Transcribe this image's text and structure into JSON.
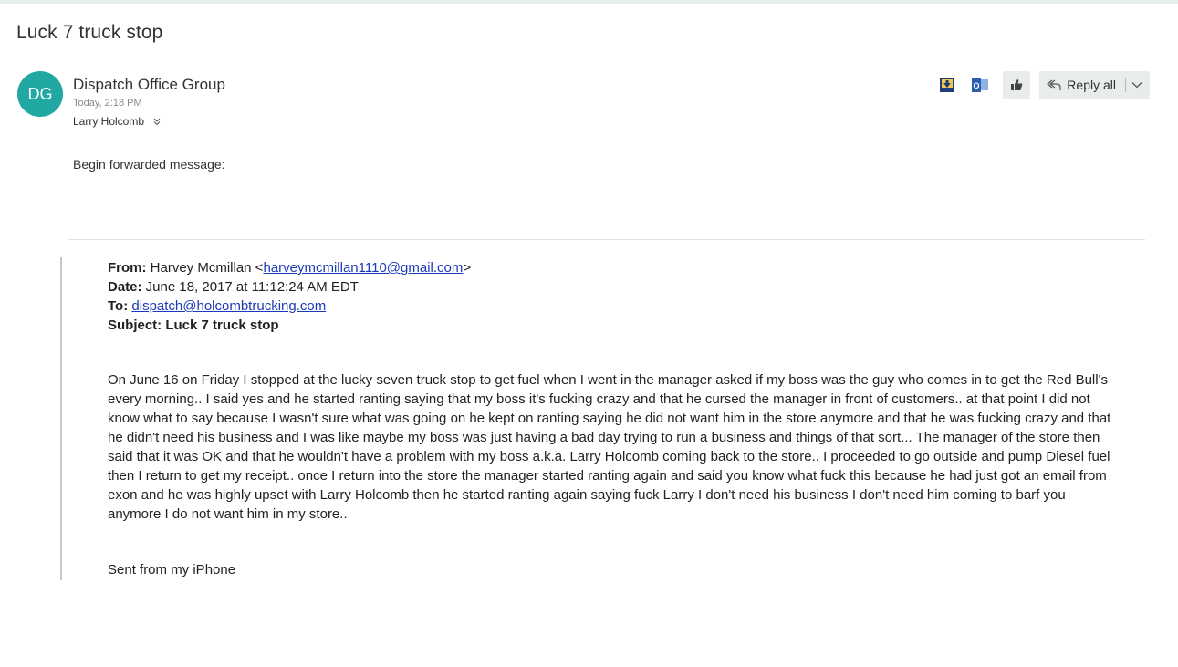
{
  "message": {
    "subject": "Luck 7 truck stop",
    "avatar_initials": "DG",
    "avatar_color": "#21a8a2",
    "sender": "Dispatch Office Group",
    "time": "Today, 2:18 PM",
    "recipient": "Larry Holcomb"
  },
  "toolbar": {
    "reply_all_label": "Reply all",
    "icons": [
      "download-addin-icon",
      "outlook-icon",
      "like-icon",
      "reply-all-icon",
      "chevron-down-icon"
    ]
  },
  "body": {
    "intro": "Begin forwarded message:",
    "forward": {
      "from_label": "From:",
      "from_name": " Harvey Mcmillan <",
      "from_email": "harveymcmillan1110@gmail.com",
      "from_close": ">",
      "date_label": "Date:",
      "date_value": " June 18, 2017 at 11:12:24 AM EDT",
      "to_label": "To:",
      "to_email": "dispatch@holcombtrucking.com",
      "subject_label": "Subject:",
      "subject_value": " Luck 7 truck stop"
    },
    "text": "On June 16 on Friday I stopped at the lucky seven truck stop to get fuel when I went in the manager asked if my boss was the guy who comes in to get the Red Bull's every morning.. I said yes and he started ranting saying that my boss it's fucking crazy and that he cursed the manager in front of customers.. at that point I did not know what to say because I wasn't sure what was going on he kept on ranting saying he did not want him in the store anymore and that he was fucking crazy and that he didn't need his business and I was like maybe my boss was just having a bad day trying to run a business and things of that sort... The manager of the store then said that it was OK and that he wouldn't have a problem with my boss a.k.a. Larry Holcomb coming back to the store.. I proceeded to go outside and pump Diesel fuel then I return to get my receipt.. once I return into the store the manager started ranting again and said you know what fuck this because he had just got an email from exon and he was highly upset with Larry Holcomb then he started ranting again saying fuck Larry I don't need his business I don't need him coming to barf you anymore I do not want him in my store..",
    "signature": "Sent from my iPhone"
  },
  "colors": {
    "link": "#1a3ab8",
    "button_bg": "#e8ecec",
    "topbar": "#e3f0ee"
  }
}
